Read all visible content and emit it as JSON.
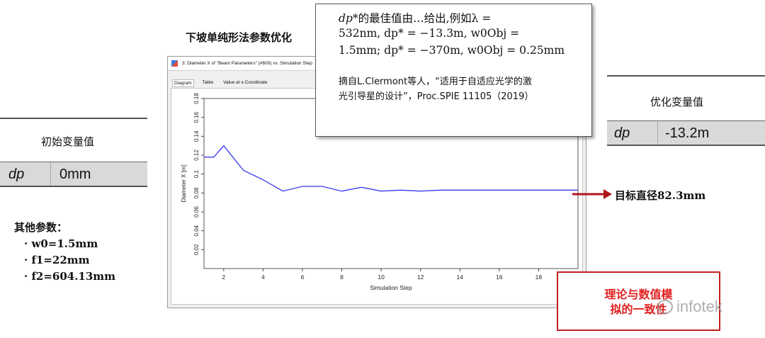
{
  "slide": {
    "title": "下坡单纯形法参数优化"
  },
  "initial": {
    "heading": "初始变量值",
    "name": "dp",
    "value": "0mm"
  },
  "other_params": {
    "heading": "其他参数：",
    "items": [
      "· w0=1.5mm",
      "· f1=22mm",
      "· f2=604.13mm"
    ]
  },
  "sim_window": {
    "title": "3: Diameter X of \"Beam Parameters\" (#600) vs. Simulation Step",
    "tabs": [
      "Diagram",
      "Table",
      "Value at x-Coordinate"
    ]
  },
  "chart_data": {
    "type": "line",
    "xlabel": "Simulation Step",
    "ylabel": "Diameter X [m]",
    "xlim": [
      1,
      20
    ],
    "ylim": [
      0,
      0.18
    ],
    "x_ticks": [
      "2",
      "4",
      "6",
      "8",
      "10",
      "12",
      "14",
      "16",
      "18"
    ],
    "y_ticks": [
      "0.02",
      "0.04",
      "0.06",
      "0.08",
      "0.1",
      "0.12",
      "0.14",
      "0.16",
      "0.18"
    ],
    "series": [
      {
        "color": "#3a3aee",
        "x": [
          1,
          1.5,
          2,
          3,
          4,
          5,
          6,
          7,
          8,
          9,
          10,
          11,
          12,
          13,
          14,
          15,
          16,
          17,
          18,
          19,
          20
        ],
        "y": [
          0.118,
          0.118,
          0.13,
          0.104,
          0.094,
          0.082,
          0.087,
          0.087,
          0.082,
          0.086,
          0.082,
          0.083,
          0.082,
          0.083,
          0.083,
          0.083,
          0.083,
          0.083,
          0.083,
          0.083,
          0.083
        ]
      }
    ],
    "grid": false
  },
  "callout": {
    "line1_a": "dp",
    "line1_b": "*的最佳值由…给出,例如λ =",
    "line2": "532nm, dp* = −13.3m, w0Obj =",
    "line3": "1.5mm; dp* = −370m, w0Obj = 0.25mm",
    "cite1": "摘自L.Clermont等人，“适用于自适应光学的激",
    "cite2": "光引导星的设计”，Proc.SPIE 11105（2019）"
  },
  "optimized": {
    "heading": "优化变量值",
    "name": "dp",
    "value": "-13.2m"
  },
  "target": {
    "text": "目标直径82.3mm",
    "arrow_color": "#b0141c"
  },
  "conclusion": {
    "line1": "理论与数值模",
    "line2": "拟的一致性"
  },
  "watermark": {
    "text": "infotek"
  }
}
